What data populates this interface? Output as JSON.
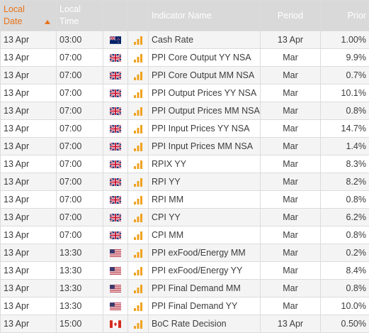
{
  "columns": {
    "date": "Local Date",
    "time": "Local Time",
    "indicator": "Indicator Name",
    "period": "Period",
    "prior": "Prior"
  },
  "rows": [
    {
      "date": "13 Apr",
      "time": "03:00",
      "flag": "nz",
      "name": "Cash Rate",
      "period": "13 Apr",
      "prior": "1.00%"
    },
    {
      "date": "13 Apr",
      "time": "07:00",
      "flag": "gb",
      "name": "PPI Core Output YY NSA",
      "period": "Mar",
      "prior": "9.9%"
    },
    {
      "date": "13 Apr",
      "time": "07:00",
      "flag": "gb",
      "name": "PPI Core Output MM NSA",
      "period": "Mar",
      "prior": "0.7%"
    },
    {
      "date": "13 Apr",
      "time": "07:00",
      "flag": "gb",
      "name": "PPI Output Prices YY NSA",
      "period": "Mar",
      "prior": "10.1%"
    },
    {
      "date": "13 Apr",
      "time": "07:00",
      "flag": "gb",
      "name": "PPI Output Prices MM NSA",
      "period": "Mar",
      "prior": "0.8%"
    },
    {
      "date": "13 Apr",
      "time": "07:00",
      "flag": "gb",
      "name": "PPI Input Prices YY NSA",
      "period": "Mar",
      "prior": "14.7%"
    },
    {
      "date": "13 Apr",
      "time": "07:00",
      "flag": "gb",
      "name": "PPI Input Prices MM NSA",
      "period": "Mar",
      "prior": "1.4%"
    },
    {
      "date": "13 Apr",
      "time": "07:00",
      "flag": "gb",
      "name": "RPIX YY",
      "period": "Mar",
      "prior": "8.3%"
    },
    {
      "date": "13 Apr",
      "time": "07:00",
      "flag": "gb",
      "name": "RPI YY",
      "period": "Mar",
      "prior": "8.2%"
    },
    {
      "date": "13 Apr",
      "time": "07:00",
      "flag": "gb",
      "name": "RPI MM",
      "period": "Mar",
      "prior": "0.8%"
    },
    {
      "date": "13 Apr",
      "time": "07:00",
      "flag": "gb",
      "name": "CPI YY",
      "period": "Mar",
      "prior": "6.2%"
    },
    {
      "date": "13 Apr",
      "time": "07:00",
      "flag": "gb",
      "name": "CPI MM",
      "period": "Mar",
      "prior": "0.8%"
    },
    {
      "date": "13 Apr",
      "time": "13:30",
      "flag": "us",
      "name": "PPI exFood/Energy MM",
      "period": "Mar",
      "prior": "0.2%"
    },
    {
      "date": "13 Apr",
      "time": "13:30",
      "flag": "us",
      "name": "PPI exFood/Energy YY",
      "period": "Mar",
      "prior": "8.4%"
    },
    {
      "date": "13 Apr",
      "time": "13:30",
      "flag": "us",
      "name": "PPI Final Demand MM",
      "period": "Mar",
      "prior": "0.8%"
    },
    {
      "date": "13 Apr",
      "time": "13:30",
      "flag": "us",
      "name": "PPI Final Demand YY",
      "period": "Mar",
      "prior": "10.0%"
    },
    {
      "date": "13 Apr",
      "time": "15:00",
      "flag": "ca",
      "name": "BoC Rate Decision",
      "period": "13 Apr",
      "prior": "0.50%"
    }
  ],
  "icons": {
    "sort": "sort-ascending-icon",
    "importance": "importance-bars-icon"
  },
  "colors": {
    "accent": "#e8731a",
    "header_bg": "#d9d9d9",
    "row_odd": "#f4f4f4",
    "row_even": "#ffffff",
    "border": "#dcdcdc",
    "bar_active": "#f0a21f",
    "bar_inactive": "#c8c8c8"
  }
}
